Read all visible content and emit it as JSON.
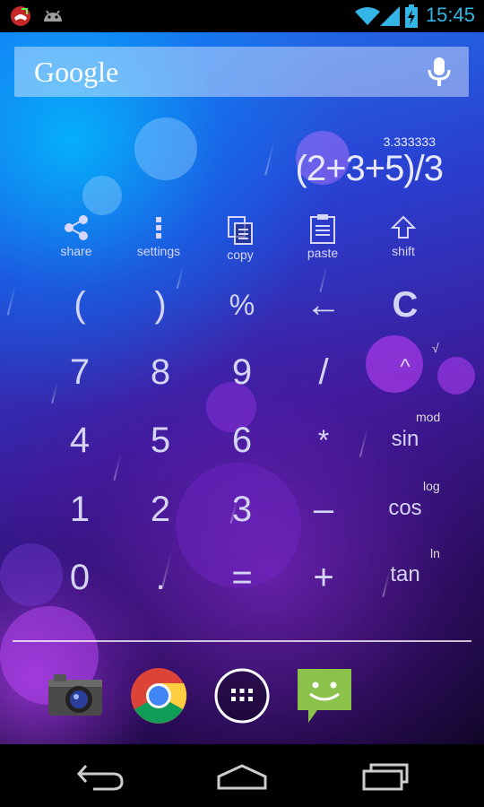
{
  "status_bar": {
    "time": "15:45",
    "left_icons": [
      "call-missed-icon",
      "android-icon"
    ],
    "right_icons": [
      "wifi-icon",
      "signal-icon",
      "battery-charging-icon"
    ],
    "accent": "#33b5e5"
  },
  "search": {
    "logo": "Google",
    "mic_icon": "microphone-icon"
  },
  "calculator": {
    "result": "3.333333",
    "expression": "(2+3+5)/3",
    "tools": [
      {
        "label": "share",
        "icon": "share-icon"
      },
      {
        "label": "settings",
        "icon": "overflow-menu-icon"
      },
      {
        "label": "copy",
        "icon": "copy-icon"
      },
      {
        "label": "paste",
        "icon": "paste-icon"
      },
      {
        "label": "shift",
        "icon": "shift-arrow-icon"
      }
    ],
    "keys": {
      "paren_open": "(",
      "paren_close": ")",
      "percent": "%",
      "backspace": "←",
      "clear": "C",
      "k7": "7",
      "k8": "8",
      "k9": "9",
      "divide": "/",
      "power": "^",
      "power_alt": "√",
      "k4": "4",
      "k5": "5",
      "k6": "6",
      "multiply": "*",
      "sin": "sin",
      "sin_alt": "mod",
      "k1": "1",
      "k2": "2",
      "k3": "3",
      "minus": "–",
      "cos": "cos",
      "cos_alt": "log",
      "k0": "0",
      "dot": ".",
      "equals": "=",
      "plus": "+",
      "tan": "tan",
      "tan_alt": "ln"
    }
  },
  "dock": {
    "apps": [
      "camera-app-icon",
      "chrome-app-icon",
      "app-drawer-icon",
      "messaging-app-icon"
    ]
  },
  "navigation": [
    "back-icon",
    "home-icon",
    "recent-apps-icon"
  ]
}
